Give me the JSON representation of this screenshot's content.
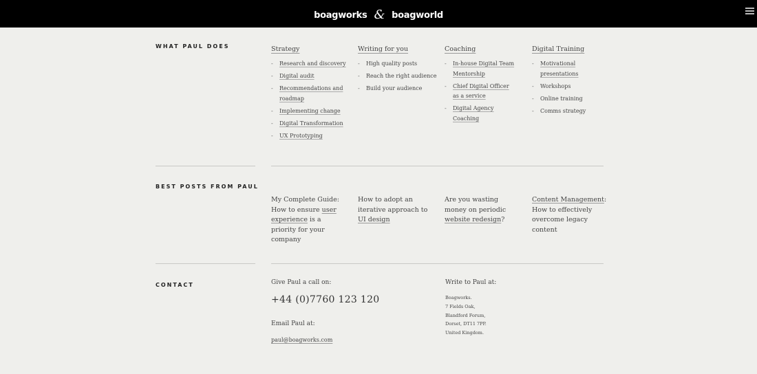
{
  "header": {
    "logo_left": "boagworks",
    "logo_amp": "&",
    "logo_right": "boagworld"
  },
  "what_paul_does": {
    "label": "WHAT PAUL DOES",
    "columns": [
      {
        "title": "Strategy",
        "items": [
          "Research and discovery",
          "Digital audit",
          "Recommendations and roadmap",
          "Implementing change",
          "Digital Transformation",
          "UX Prototyping"
        ]
      },
      {
        "title": "Writing for you",
        "items": [
          "High quality posts",
          "Reach the right audience",
          "Build your audience"
        ]
      },
      {
        "title": "Coaching",
        "items": [
          "In-house Digital Team Mentorship",
          "Chief Digital Officer as a service",
          "Digital Agency Coaching"
        ]
      },
      {
        "title": "Digital Training",
        "items": [
          "Motivational presentations",
          "Workshops",
          "Online training",
          "Comms strategy"
        ]
      }
    ]
  },
  "best_posts": {
    "label": "BEST POSTS FROM PAUL",
    "posts": [
      {
        "a": "My Complete Guide: How to ensure ",
        "link": "user experience",
        "b": " is a priority for your company"
      },
      {
        "a": "How to adopt an iterative approach to ",
        "link": "UI design",
        "b": ""
      },
      {
        "a": "Are you wasting money on periodic ",
        "link": "website redesign",
        "b": "?"
      },
      {
        "a": "",
        "link": "Content Management",
        "b": ": How to effectively overcome legacy content"
      }
    ]
  },
  "contact": {
    "label": "CONTACT",
    "call_label": "Give Paul a call on:",
    "phone": "+44 (0)7760 123 120",
    "email_label": "Email Paul at:",
    "email": "paul@boagworks.com",
    "write_label": "Write to Paul at:",
    "address": [
      "Boagworks.",
      "7 Fields Oak,",
      "Blandford Forum,",
      "Dorset, DT11 7PP.",
      "United Kingdom."
    ]
  }
}
